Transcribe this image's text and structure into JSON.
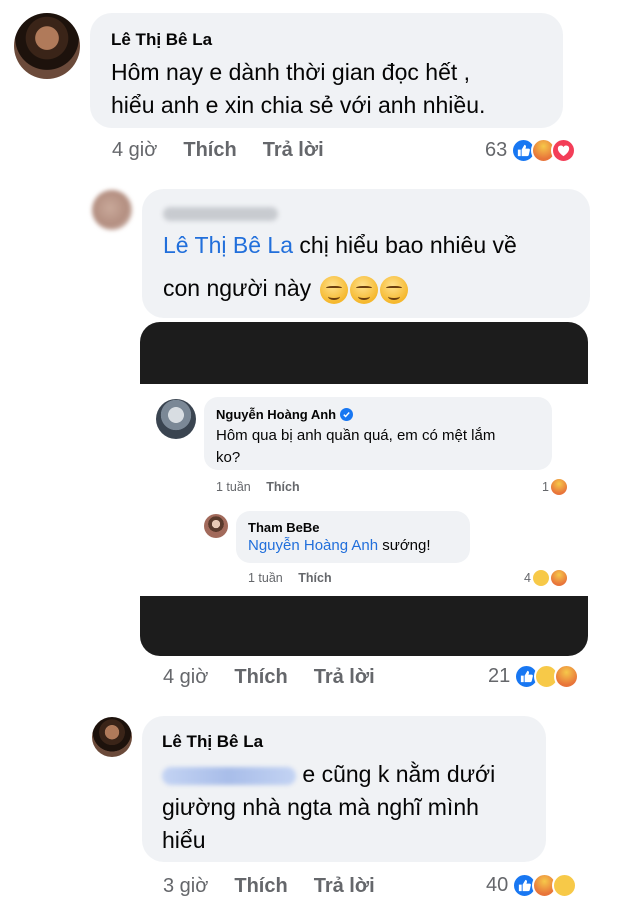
{
  "comment1": {
    "author": "Lê Thị Bê La",
    "text_line1": "Hôm nay e dành thời gian đọc hết ,",
    "text_line2": "hiểu anh e xin chia sẻ với anh nhiều.",
    "time": "4 giờ",
    "like_label": "Thích",
    "reply_label": "Trả lời",
    "reaction_count": "63",
    "reactions": [
      "like-icon",
      "angry-icon",
      "love-icon"
    ]
  },
  "comment2": {
    "mention": "Lê Thị Bê La",
    "text_line1_rest": " chị hiểu bao nhiêu về",
    "text_line2": "con người này",
    "emojis": [
      "smirk-emoji",
      "smirk-emoji",
      "smirk-emoji"
    ],
    "time": "4 giờ",
    "like_label": "Thích",
    "reply_label": "Trả lời",
    "reaction_count": "21",
    "reactions": [
      "like-icon",
      "haha-icon",
      "angry-icon"
    ],
    "screenshot": {
      "c1": {
        "author": "Nguyễn Hoàng Anh",
        "text_line1": "Hôm qua bị anh quần quá, em có mệt lắm",
        "text_line2": "ko?",
        "time": "1 tuần",
        "like_label": "Thích",
        "reaction_count": "1"
      },
      "c2": {
        "author": "Tham BeBe",
        "mention": "Nguyễn Hoàng Anh",
        "text_rest": " sướng!",
        "time": "1 tuần",
        "like_label": "Thích",
        "reaction_count": "4"
      }
    }
  },
  "comment3": {
    "author": "Lê Thị Bê La",
    "text_line1_rest": " e cũng k nằm dưới",
    "text_line2": "giường nhà ngta mà nghĩ mình",
    "text_line3": "hiểu",
    "time": "3 giờ",
    "like_label": "Thích",
    "reply_label": "Trả lời",
    "reaction_count": "40",
    "reactions": [
      "like-icon",
      "angry-icon",
      "haha-icon"
    ]
  },
  "colors": {
    "bubble": "#f0f2f5",
    "mention": "#216fdb",
    "meta": "#65676b",
    "like": "#1877f2",
    "love": "#f33e58"
  }
}
